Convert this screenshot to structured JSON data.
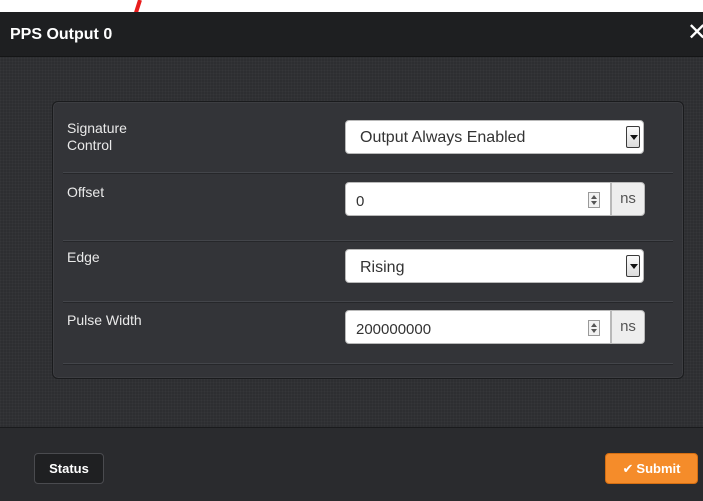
{
  "dialog": {
    "title": "PPS Output 0",
    "close_glyph": "✕"
  },
  "form": {
    "signature_control": {
      "label": "Signature\nControl",
      "value": "Output Always Enabled"
    },
    "offset": {
      "label": "Offset",
      "value": "0",
      "unit": "ns"
    },
    "edge": {
      "label": "Edge",
      "value": "Rising"
    },
    "pulse_width": {
      "label": "Pulse Width",
      "value": "200000000",
      "unit": "ns"
    }
  },
  "footer": {
    "status_label": "Status",
    "submit_label": "Submit",
    "submit_icon": "check-icon"
  },
  "colors": {
    "submit": "#f58c2a",
    "annotation_arrow": "#e81c1c"
  }
}
